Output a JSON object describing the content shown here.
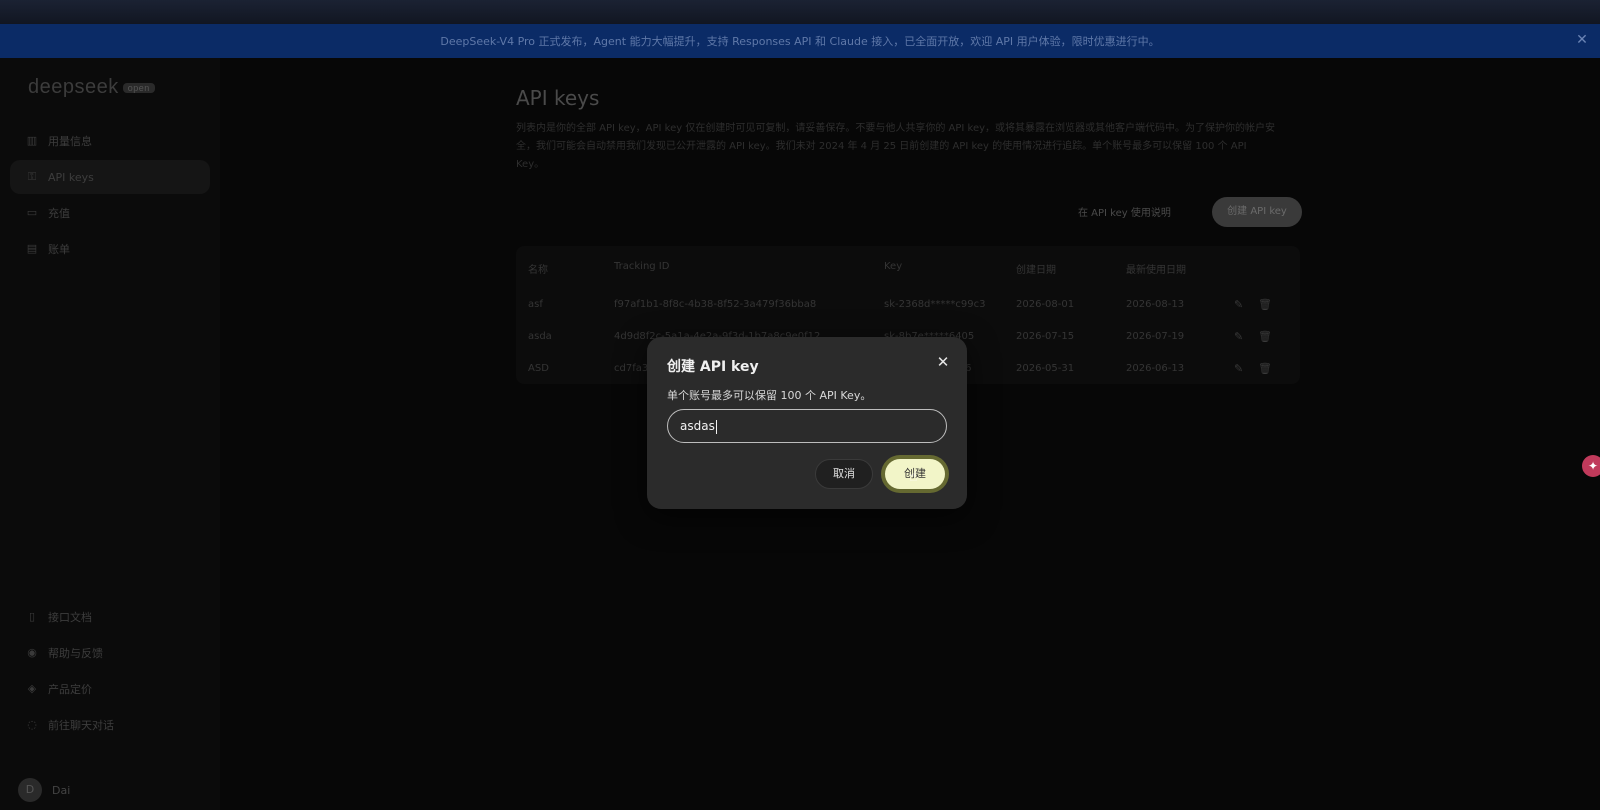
{
  "banner": {
    "text": "DeepSeek-V4 Pro 正式发布，Agent 能力大幅提升，支持 Responses API 和 Claude 接入，已全面开放，欢迎 API 用户体验，限时优惠进行中。",
    "close_icon": "close-icon"
  },
  "sidebar": {
    "logo": "deepseek",
    "logo_tag": "open",
    "items": [
      {
        "label": "用量信息",
        "icon": "chart-icon"
      },
      {
        "label": "API keys",
        "icon": "key-icon"
      },
      {
        "label": "充值",
        "icon": "wallet-icon"
      },
      {
        "label": "账单",
        "icon": "bill-icon"
      }
    ],
    "bottom_items": [
      {
        "label": "接口文档",
        "icon": "doc-icon"
      },
      {
        "label": "帮助与反馈",
        "icon": "help-icon"
      },
      {
        "label": "产品定价",
        "icon": "price-icon"
      },
      {
        "label": "前往聊天对话",
        "icon": "chat-icon"
      }
    ],
    "user": {
      "avatar": "D",
      "name": "Dai"
    }
  },
  "main": {
    "title": "API keys",
    "description": "列表内是你的全部 API key，API key 仅在创建时可见可复制，请妥善保存。不要与他人共享你的 API key，或将其暴露在浏览器或其他客户端代码中。为了保护你的帐户安全，我们可能会自动禁用我们发现已公开泄露的 API key。我们未对 2024 年 4 月 25 日前创建的 API key 的使用情况进行追踪。单个账号最多可以保留 100 个 API Key。",
    "link_label": "在 API key 使用说明",
    "create_label": "创建 API key",
    "table": {
      "headers": [
        "名称",
        "Tracking ID",
        "Key",
        "创建日期",
        "最新使用日期"
      ],
      "rows": [
        {
          "name": "asf",
          "tracking": "f97af1b1-8f8c-4b38-8f52-3a479f36bba8",
          "key": "sk-2368d*****c99c3",
          "created": "2026-08-01",
          "used": "2026-08-13"
        },
        {
          "name": "asda",
          "tracking": "4d9d8f2c-5a1a-4e2a-9f3d-1b7a8c9e0f12",
          "key": "sk-8b7e*****6405",
          "created": "2026-07-15",
          "used": "2026-07-19"
        },
        {
          "name": "ASD",
          "tracking": "cd7fa3b2-1c2d-4e5f-8a9b-0c1d2e3f4a5b",
          "key": "sk-1f2e*****0216",
          "created": "2026-05-31",
          "used": "2026-06-13"
        }
      ]
    }
  },
  "modal": {
    "title": "创建 API key",
    "subtitle": "单个账号最多可以保留 100 个 API Key。",
    "input_value": "asdas",
    "cancel_label": "取消",
    "create_label": "创建"
  },
  "colors": {
    "accent_create": "#f2f5c8",
    "banner_bg": "#0b2b66"
  }
}
